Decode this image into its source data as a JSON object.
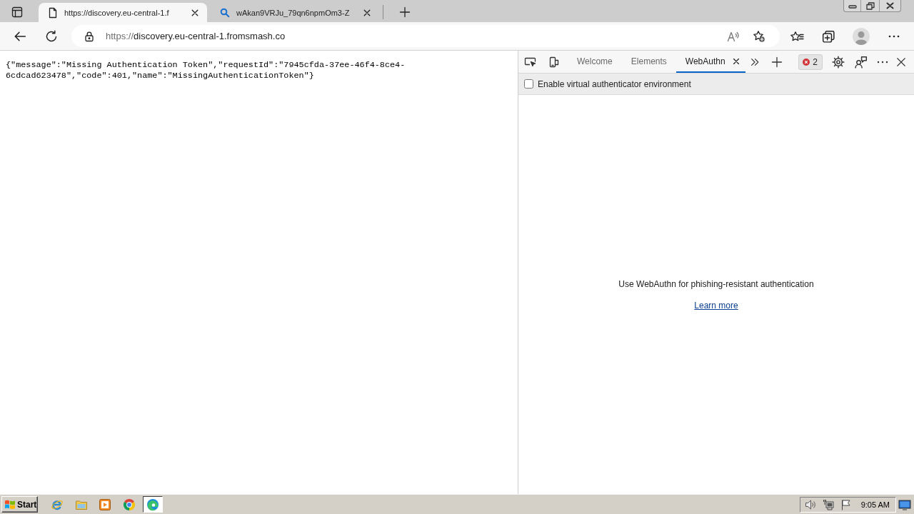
{
  "browser": {
    "tabs": [
      {
        "title": "https://discovery.eu-central-1.f",
        "selected": true
      },
      {
        "title": "wAkan9VRJu_79qn6npmOm3-Z",
        "selected": false
      }
    ],
    "address_bar": {
      "scheme": "https://",
      "host": "discovery.eu-central-1.fromsmash.co"
    }
  },
  "page": {
    "body": "{\"message\":\"Missing Authentication Token\",\"requestId\":\"7945cfda-37ee-46f4-8ce4-6cdcad623478\",\"code\":401,\"name\":\"MissingAuthenticationToken\"}"
  },
  "devtools": {
    "tabs": [
      {
        "label": "Welcome",
        "selected": false
      },
      {
        "label": "Elements",
        "selected": false
      },
      {
        "label": "WebAuthn",
        "selected": true
      }
    ],
    "issues_count": "2",
    "virtual_authenticator": {
      "label": "Enable virtual authenticator environment",
      "checked": false
    },
    "empty_state": {
      "message": "Use WebAuthn for phishing-resistant authentication",
      "link": "Learn more"
    }
  },
  "taskbar": {
    "start_label": "Start",
    "apps": [
      {
        "kind": "ie",
        "selected": false
      },
      {
        "kind": "explorer",
        "selected": false
      },
      {
        "kind": "media",
        "selected": false
      },
      {
        "kind": "chrome",
        "selected": false
      },
      {
        "kind": "edge",
        "selected": true
      }
    ],
    "clock": "9:05 AM"
  }
}
